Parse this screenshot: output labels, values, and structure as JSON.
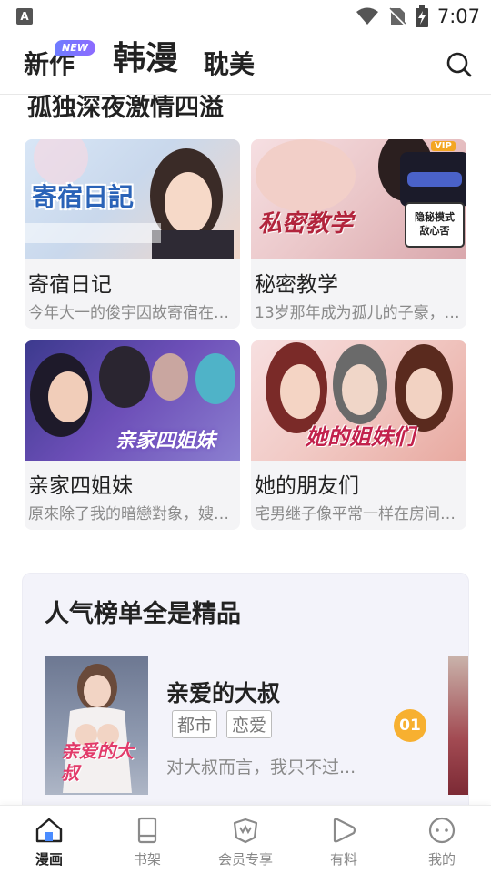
{
  "status_bar": {
    "app_icon": "A",
    "time": "7:07",
    "icons": [
      "wifi-icon",
      "no-sim-icon",
      "battery-charging-icon"
    ]
  },
  "header": {
    "tabs": [
      {
        "label": "新作",
        "active": false,
        "badge": "NEW"
      },
      {
        "label": "韩漫",
        "active": true
      },
      {
        "label": "耽美",
        "active": false
      }
    ],
    "search_icon": "search-icon"
  },
  "section_heading": "孤独深夜激情四溢",
  "cards": [
    {
      "title": "寄宿日记",
      "desc": "今年大一的俊宇因故寄宿在…",
      "cover_title": "寄宿日記"
    },
    {
      "title": "秘密教学",
      "desc": "13岁那年成为孤儿的子豪，…",
      "cover_title": "私密教学",
      "cover_tag": "隐秘模式 敌心否",
      "cover_vip": "VIP"
    },
    {
      "title": "亲家四姐妹",
      "desc": "原來除了我的暗戀對象，嫂…",
      "cover_title": "亲家四姐妹"
    },
    {
      "title": "她的朋友们",
      "desc": "宅男继子像平常一样在房间…",
      "cover_title": "她的姐妹们"
    }
  ],
  "ranking": {
    "title": "人气榜单全是精品",
    "items": [
      {
        "rank": "01",
        "name": "亲爱的大叔",
        "tags": [
          "都市",
          "恋爱"
        ],
        "desc": "对大叔而言，我只不过...",
        "cover_title": "亲爱的大叔"
      }
    ]
  },
  "bottom_nav": [
    {
      "label": "漫画",
      "icon": "home-icon",
      "active": true
    },
    {
      "label": "书架",
      "icon": "bookshelf-icon",
      "active": false
    },
    {
      "label": "会员专享",
      "icon": "vip-crown-icon",
      "active": false
    },
    {
      "label": "有料",
      "icon": "play-icon",
      "active": false
    },
    {
      "label": "我的",
      "icon": "profile-icon",
      "active": false
    }
  ],
  "colors": {
    "accent": "#f7b030",
    "badge": "#7a74ff",
    "card_bg": "#f4f4f6",
    "rank_bg": "#f3f3fa"
  }
}
